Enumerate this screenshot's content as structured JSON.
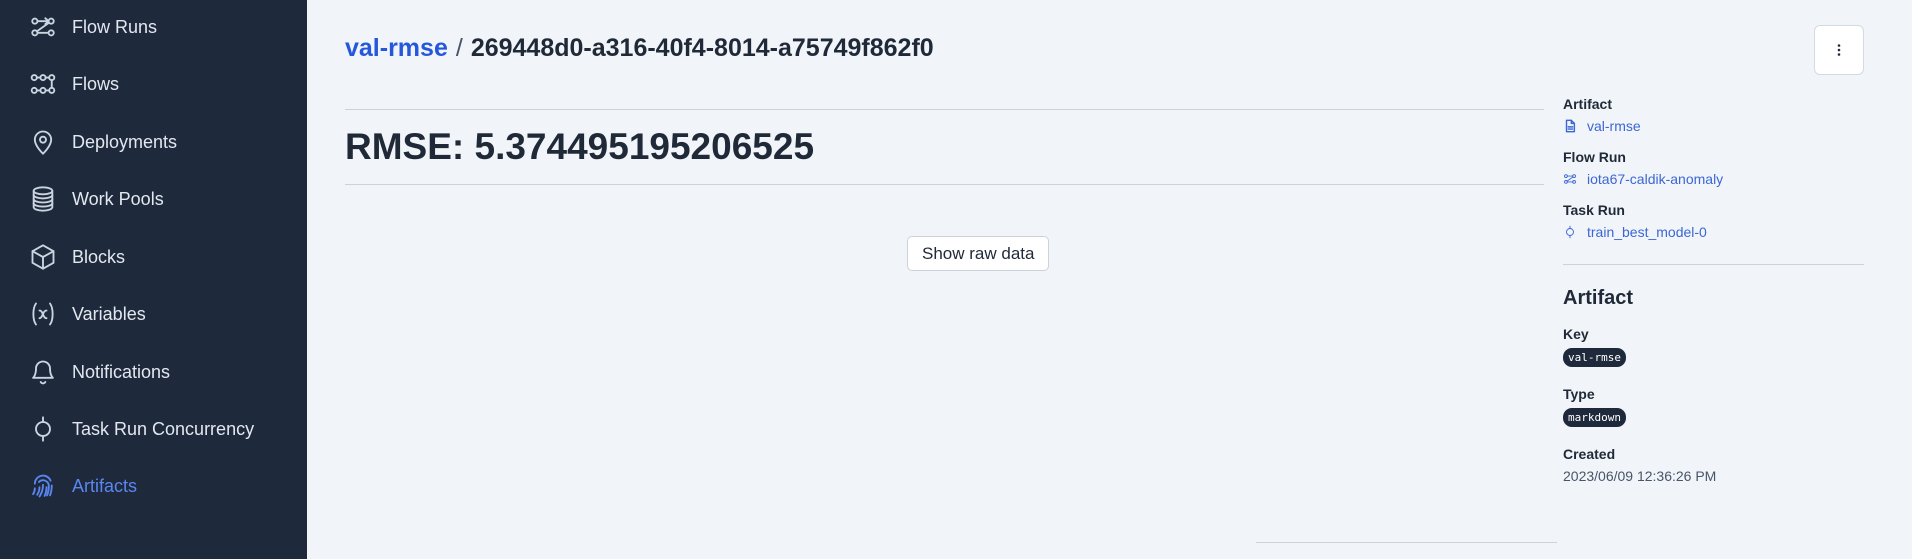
{
  "sidebar": {
    "items": [
      {
        "label": "Flow Runs",
        "icon": "flow-runs-icon",
        "active": false
      },
      {
        "label": "Flows",
        "icon": "flows-icon",
        "active": false
      },
      {
        "label": "Deployments",
        "icon": "map-pin-icon",
        "active": false
      },
      {
        "label": "Work Pools",
        "icon": "database-icon",
        "active": false
      },
      {
        "label": "Blocks",
        "icon": "cube-icon",
        "active": false
      },
      {
        "label": "Variables",
        "icon": "variable-icon",
        "active": false
      },
      {
        "label": "Notifications",
        "icon": "bell-icon",
        "active": false
      },
      {
        "label": "Task Run Concurrency",
        "icon": "task-run-icon",
        "active": false
      },
      {
        "label": "Artifacts",
        "icon": "fingerprint-icon",
        "active": true
      }
    ]
  },
  "header": {
    "breadcrumb_link": "val-rmse",
    "separator": "/",
    "artifact_id": "269448d0-a316-40f4-8014-a75749f862f0"
  },
  "main": {
    "metric": "RMSE: 5.374495195206525",
    "raw_button": "Show raw data"
  },
  "details": {
    "artifact_label": "Artifact",
    "artifact_link": "val-rmse",
    "flow_run_label": "Flow Run",
    "flow_run_link": "iota67-caldik-anomaly",
    "task_run_label": "Task Run",
    "task_run_link": "train_best_model-0",
    "section_title": "Artifact",
    "key_label": "Key",
    "key_value": "val-rmse",
    "type_label": "Type",
    "type_value": "markdown",
    "created_label": "Created",
    "created_value": "2023/06/09 12:36:26 PM"
  },
  "colors": {
    "sidebar_bg": "#1e293b",
    "page_bg": "#f1f5f9",
    "link": "#2457db",
    "active_nav": "#5a86f0"
  }
}
